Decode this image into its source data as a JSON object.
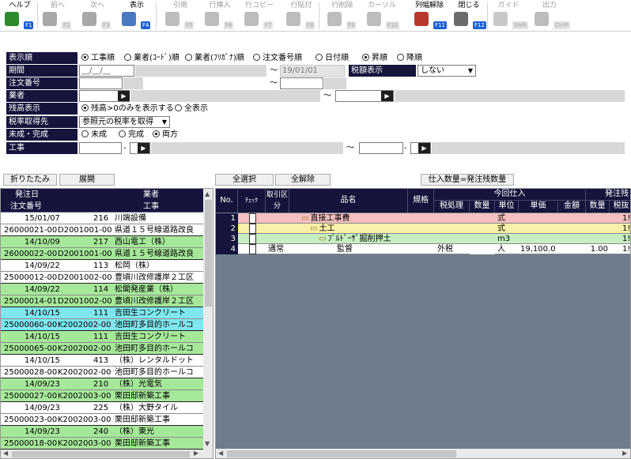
{
  "toolbar": [
    {
      "label": "ヘルプ",
      "key": "F1",
      "icon": "question-icon",
      "enabled": true
    },
    {
      "label": "前へ",
      "key": "F2",
      "icon": "arrow-left-icon",
      "enabled": false
    },
    {
      "label": "次へ",
      "key": "F3",
      "icon": "arrow-right-icon",
      "enabled": false
    },
    {
      "label": "表示",
      "key": "F4",
      "icon": "magnifier-icon",
      "enabled": true
    },
    {
      "label": "引用",
      "key": "F5",
      "icon": "quote-icon",
      "enabled": false
    },
    {
      "label": "行挿入",
      "key": "F6",
      "icon": "insert-row-icon",
      "enabled": false
    },
    {
      "label": "行コピー",
      "key": "F7",
      "icon": "copy-row-icon",
      "enabled": false
    },
    {
      "label": "行貼付",
      "key": "F8",
      "icon": "paste-row-icon",
      "enabled": false
    },
    {
      "label": "行削除",
      "key": "F9",
      "icon": "delete-row-icon",
      "enabled": false
    },
    {
      "label": "カーソル",
      "key": "F10",
      "icon": "cursor-icon",
      "enabled": false
    },
    {
      "label": "列幅解除",
      "key": "F11",
      "icon": "column-width-icon",
      "enabled": true
    },
    {
      "label": "閉じる",
      "key": "F12",
      "icon": "close-door-icon",
      "enabled": true
    },
    {
      "label": "ガイド",
      "key": "Shift",
      "icon": "lightbulb-icon",
      "enabled": false
    },
    {
      "label": "出力",
      "key": "CtrlP",
      "icon": "output-icon",
      "enabled": false
    }
  ],
  "form": {
    "display_order_label": "表示順",
    "sort_options": [
      "工事順",
      "業者(ｺｰﾄﾞ)順",
      "業者(ﾌﾘｶﾞﾅ)順",
      "注文番号順",
      "日付順"
    ],
    "sort_selected": "工事順",
    "dir_options": [
      "昇順",
      "降順"
    ],
    "dir_selected": "昇順",
    "period_label": "期間",
    "period_from": "__/__/__",
    "period_tilde": "～",
    "period_to": "19/01/01",
    "tax_display_label": "税額表示",
    "tax_display_value": "しない",
    "order_no_label": "注文番号",
    "order_tilde": "～",
    "vendor_label": "業者",
    "vendor_tilde": "～",
    "balance_label": "残高表示",
    "balance_options": [
      "残高>0のみを表示する",
      "全表示"
    ],
    "balance_selected": "残高>0のみを表示する",
    "tax_rate_label": "税率取得先",
    "tax_rate_value": "参照元の税率を取得",
    "status_label": "未成・完成",
    "status_options": [
      "未成",
      "完成",
      "両方"
    ],
    "status_selected": "両方",
    "project_label": "工事",
    "project_dash1": "-",
    "project_tilde": "～",
    "project_dash2": "-",
    "go_symbol": "▶"
  },
  "buttons": {
    "collapse": "折りたたみ",
    "expand": "展開",
    "select_all": "全選択",
    "deselect_all": "全解除",
    "qty_button": "仕入数量=発注残数量"
  },
  "left_headers": {
    "date": "発注日",
    "vendor": "業者",
    "order_no": "注文番号",
    "project": "工事"
  },
  "left_rows": [
    {
      "date": "15/01/07",
      "code": "216",
      "name": "川端設備",
      "order": "26000021-00",
      "pcode": "D2001001-00",
      "pname": "県道１５号線道路改良",
      "color": "#ffffff"
    },
    {
      "date": "14/10/09",
      "code": "217",
      "name": "西山電工（株）",
      "order": "26000022-00",
      "pcode": "D2001001-00",
      "pname": "県道１５号線道路改良",
      "color": "#a6e89a"
    },
    {
      "date": "14/09/22",
      "code": "113",
      "name": "松岡（株）",
      "order": "25000012-00",
      "pcode": "D2001002-00",
      "pname": "豊頃川改修護岸２工区",
      "color": "#ffffff"
    },
    {
      "date": "14/09/22",
      "code": "114",
      "name": "松閣発産業（株）",
      "order": "25000014-01",
      "pcode": "D2001002-00",
      "pname": "豊頃川改修護岸２工区",
      "color": "#a6e89a"
    },
    {
      "date": "14/10/15",
      "code": "111",
      "name": "吉田生コンクリート",
      "order": "25000060-00",
      "pcode": "K2002002-00",
      "pname": "池田町多目的ホールコ",
      "color": "#7fe6ee"
    },
    {
      "date": "14/10/15",
      "code": "111",
      "name": "吉田生コンクリート",
      "order": "25000065-00",
      "pcode": "K2002002-00",
      "pname": "池田町多目的ホールコ",
      "color": "#a6e89a"
    },
    {
      "date": "14/10/15",
      "code": "413",
      "name": "（株）レンタルドット",
      "order": "25000028-00",
      "pcode": "K2002002-00",
      "pname": "池田町多目的ホールコ",
      "color": "#ffffff"
    },
    {
      "date": "14/09/23",
      "code": "210",
      "name": "（株）光電気",
      "order": "25000027-00",
      "pcode": "K2002003-00",
      "pname": "栗田邸新築工事",
      "color": "#a6e89a"
    },
    {
      "date": "14/09/23",
      "code": "225",
      "name": "（株）大野タイル",
      "order": "25000023-00",
      "pcode": "K2002003-00",
      "pname": "栗田邸新築工事",
      "color": "#ffffff"
    },
    {
      "date": "14/09/23",
      "code": "240",
      "name": "（株）東光",
      "order": "25000018-00",
      "pcode": "K2002003-00",
      "pname": "栗田邸新築工事",
      "color": "#a6e89a"
    }
  ],
  "right_headers": {
    "no": "No.",
    "check": "ﾁｪｯｸ",
    "torihiki": "取引区分",
    "item": "品名",
    "spec": "規格",
    "this_purchase": "今回仕入",
    "tax_proc": "税処理",
    "qty": "数量",
    "unit": "単位",
    "price": "単価",
    "amount": "金額",
    "order_bal": "発注残",
    "qty2": "数量",
    "tax2": "税抜"
  },
  "right_rows": [
    {
      "no": "1",
      "torihiki": "",
      "item": "直接工事費",
      "indent": 1,
      "tax": "",
      "unit": "式",
      "price": "",
      "qty2": "",
      "tax2": "1!",
      "color": "#f5c0c0"
    },
    {
      "no": "2",
      "torihiki": "",
      "item": "土工",
      "indent": 2,
      "tax": "",
      "unit": "式",
      "price": "",
      "qty2": "",
      "tax2": "1!",
      "color": "#f7f0a8"
    },
    {
      "no": "3",
      "torihiki": "",
      "item": "ﾌﾞﾙﾄﾞｰｻﾞ掘削押土",
      "indent": 3,
      "tax": "",
      "unit": "m3",
      "price": "",
      "qty2": "",
      "tax2": "1!",
      "color": "#c6eec0"
    },
    {
      "no": "4",
      "torihiki": "通常",
      "item": "監督",
      "indent": 0,
      "tax": "外税",
      "unit": "人",
      "price": "19,100.0",
      "qty2": "1.00",
      "tax2": "1!",
      "color": "#ffffff"
    }
  ]
}
